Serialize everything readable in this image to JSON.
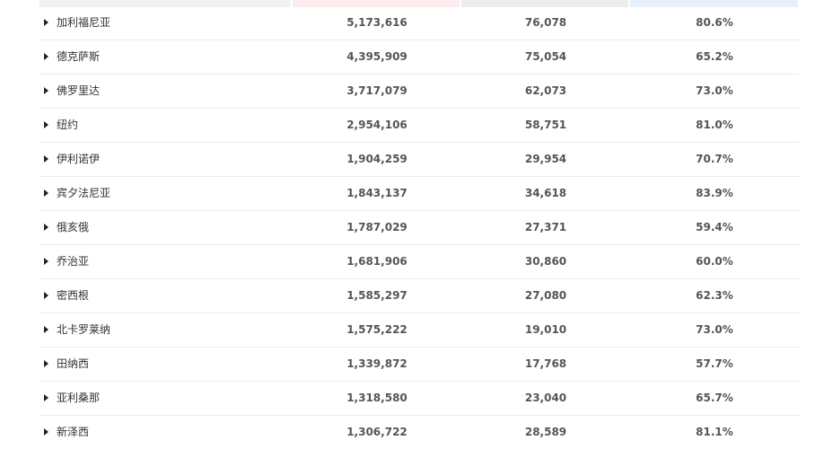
{
  "colors": {
    "header_name": "#f2f2f2",
    "header_c1": "#fdeced",
    "header_c2": "#ececec",
    "header_c3": "#e7effb",
    "row_divider": "#ebebeb"
  },
  "icons": {
    "row_expand": "caret-right-icon"
  },
  "rows": [
    {
      "name": "加利福尼亚",
      "v1": "5,173,616",
      "v2": "76,078",
      "v3": "80.6%"
    },
    {
      "name": "德克萨斯",
      "v1": "4,395,909",
      "v2": "75,054",
      "v3": "65.2%"
    },
    {
      "name": "佛罗里达",
      "v1": "3,717,079",
      "v2": "62,073",
      "v3": "73.0%"
    },
    {
      "name": "纽约",
      "v1": "2,954,106",
      "v2": "58,751",
      "v3": "81.0%"
    },
    {
      "name": "伊利诺伊",
      "v1": "1,904,259",
      "v2": "29,954",
      "v3": "70.7%"
    },
    {
      "name": "宾夕法尼亚",
      "v1": "1,843,137",
      "v2": "34,618",
      "v3": "83.9%"
    },
    {
      "name": "俄亥俄",
      "v1": "1,787,029",
      "v2": "27,371",
      "v3": "59.4%"
    },
    {
      "name": "乔治亚",
      "v1": "1,681,906",
      "v2": "30,860",
      "v3": "60.0%"
    },
    {
      "name": "密西根",
      "v1": "1,585,297",
      "v2": "27,080",
      "v3": "62.3%"
    },
    {
      "name": "北卡罗莱纳",
      "v1": "1,575,222",
      "v2": "19,010",
      "v3": "73.0%"
    },
    {
      "name": "田纳西",
      "v1": "1,339,872",
      "v2": "17,768",
      "v3": "57.7%"
    },
    {
      "name": "亚利桑那",
      "v1": "1,318,580",
      "v2": "23,040",
      "v3": "65.7%"
    },
    {
      "name": "新泽西",
      "v1": "1,306,722",
      "v2": "28,589",
      "v3": "81.1%"
    }
  ]
}
